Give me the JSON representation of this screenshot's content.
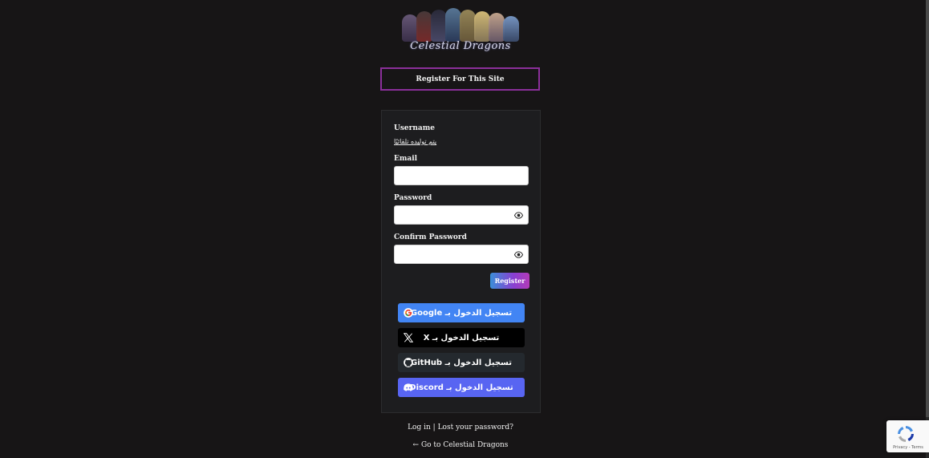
{
  "site": {
    "logo_text": "Celestial Dragons"
  },
  "banner": {
    "title": "Register For This Site"
  },
  "form": {
    "username_label": "Username",
    "username_note": "يتم توليده تلقائيًا",
    "email_label": "Email",
    "email_value": "",
    "password_label": "Password",
    "password_value": "",
    "confirm_label": "Confirm Password",
    "confirm_value": "",
    "register_label": "Register"
  },
  "social": [
    {
      "provider": "Google",
      "label": "تسجيل الدخول بـ Google",
      "color": "#4285f4",
      "icon": "google-icon"
    },
    {
      "provider": "X",
      "label": "تسجيل الدخول بـ X",
      "color": "#000000",
      "icon": "x-icon"
    },
    {
      "provider": "GitHub",
      "label": "تسجيل الدخول بـ GitHub",
      "color": "#24292e",
      "icon": "github-icon"
    },
    {
      "provider": "Discord",
      "label": "تسجيل الدخول بـ Discord",
      "color": "#5865f2",
      "icon": "discord-icon"
    }
  ],
  "footer": {
    "login_link": "Log in",
    "separator": "|",
    "lost_password_link": "Lost your password?",
    "back_link": "← Go to Celestial Dragons"
  },
  "recaptcha": {
    "text": "Privacy - Terms"
  },
  "colors": {
    "background": "#171516",
    "accent_border": "#8b2f9a",
    "card": "#1d1d1f"
  }
}
